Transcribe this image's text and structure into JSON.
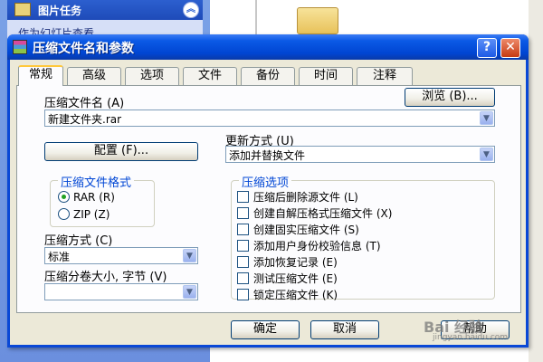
{
  "background": {
    "task_header": "图片任务",
    "task_item": "作为幻灯片查看"
  },
  "dialog": {
    "title": "压缩文件名和参数",
    "help_glyph": "?",
    "close_glyph": "✕",
    "tabs": [
      {
        "label": "常规"
      },
      {
        "label": "高级"
      },
      {
        "label": "选项"
      },
      {
        "label": "文件"
      },
      {
        "label": "备份"
      },
      {
        "label": "时间"
      },
      {
        "label": "注释"
      }
    ],
    "archive_name": {
      "label": "压缩文件名 (A)",
      "value": "新建文件夹.rar",
      "browse_label": "浏览 (B)..."
    },
    "profiles_label": "配置 (F)...",
    "update_mode": {
      "label": "更新方式 (U)",
      "value": "添加并替换文件"
    },
    "archive_format": {
      "legend": "压缩文件格式",
      "options": [
        {
          "label": "RAR (R)",
          "selected": true
        },
        {
          "label": "ZIP (Z)",
          "selected": false
        }
      ]
    },
    "compression_method": {
      "label": "压缩方式 (C)",
      "value": "标准"
    },
    "split_volumes": {
      "label": "压缩分卷大小, 字节 (V)",
      "value": ""
    },
    "archive_options": {
      "legend": "压缩选项",
      "items": [
        {
          "label": "压缩后删除源文件 (L)",
          "checked": false
        },
        {
          "label": "创建自解压格式压缩文件 (X)",
          "checked": false
        },
        {
          "label": "创建固实压缩文件 (S)",
          "checked": false
        },
        {
          "label": "添加用户身份校验信息 (T)",
          "checked": false
        },
        {
          "label": "添加恢复记录 (E)",
          "checked": false
        },
        {
          "label": "测试压缩文件 (E)",
          "checked": false
        },
        {
          "label": "锁定压缩文件 (K)",
          "checked": false
        }
      ]
    },
    "buttons": {
      "ok": "确定",
      "cancel": "取消",
      "help": "帮助"
    }
  },
  "watermark": {
    "text": "Bai 经验",
    "sub": "jingyan.baidu.com"
  },
  "colors": {
    "titlebar": "#0045d2",
    "dialog_bg": "#ece9d8",
    "legend_text": "#0046d5",
    "active_tab_accent": "#ffc83c"
  }
}
